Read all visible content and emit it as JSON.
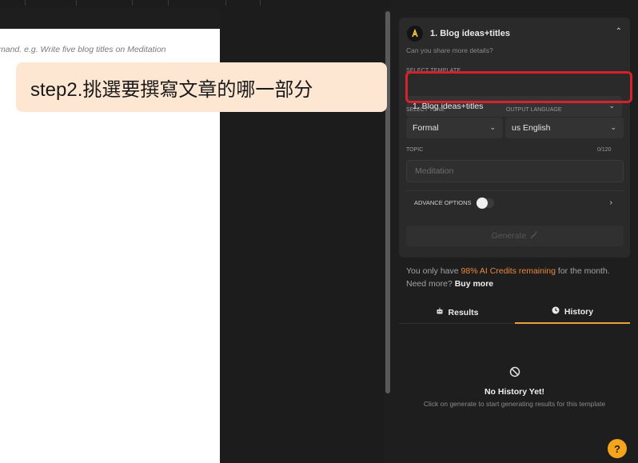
{
  "editor": {
    "placeholder": "mand. e.g. Write five blog titles on Meditation"
  },
  "callout": {
    "text": "step2.挑選要撰寫文章的哪一部分"
  },
  "panel": {
    "template_header": {
      "icon": "template-logo-icon",
      "title": "1. Blog ideas+titles",
      "subtitle": "Can you share more details?"
    },
    "select_template": {
      "label": "SELECT TEMPLATE",
      "value": "1. Blog ideas+titles"
    },
    "tone": {
      "label": "SELECT TONE",
      "value": "Formal"
    },
    "language": {
      "label": "OUTPUT LANGUAGE",
      "value": "us English"
    },
    "topic": {
      "label": "TOPIC",
      "counter": "0/120",
      "placeholder": "Meditation"
    },
    "advance_options": {
      "label": "ADVANCE OPTIONS",
      "toggle": "off"
    },
    "generate_label": "Generate",
    "credits": {
      "prefix": "You only have ",
      "highlight": "98% AI Credits remaining",
      "middle": " for the month. Need more? ",
      "buy": "Buy more"
    },
    "tabs": {
      "results": "Results",
      "history": "History",
      "active": "History"
    },
    "empty_state": {
      "title": "No History Yet!",
      "subtitle": "Click on generate to start generating results for this template"
    },
    "help_label": "?"
  },
  "colors": {
    "accent_orange": "#e8893a",
    "tab_underline": "#e8a33a",
    "highlight_border": "#d4212b",
    "help_button": "#f4a51c",
    "callout_bg": "#fde7d3"
  }
}
